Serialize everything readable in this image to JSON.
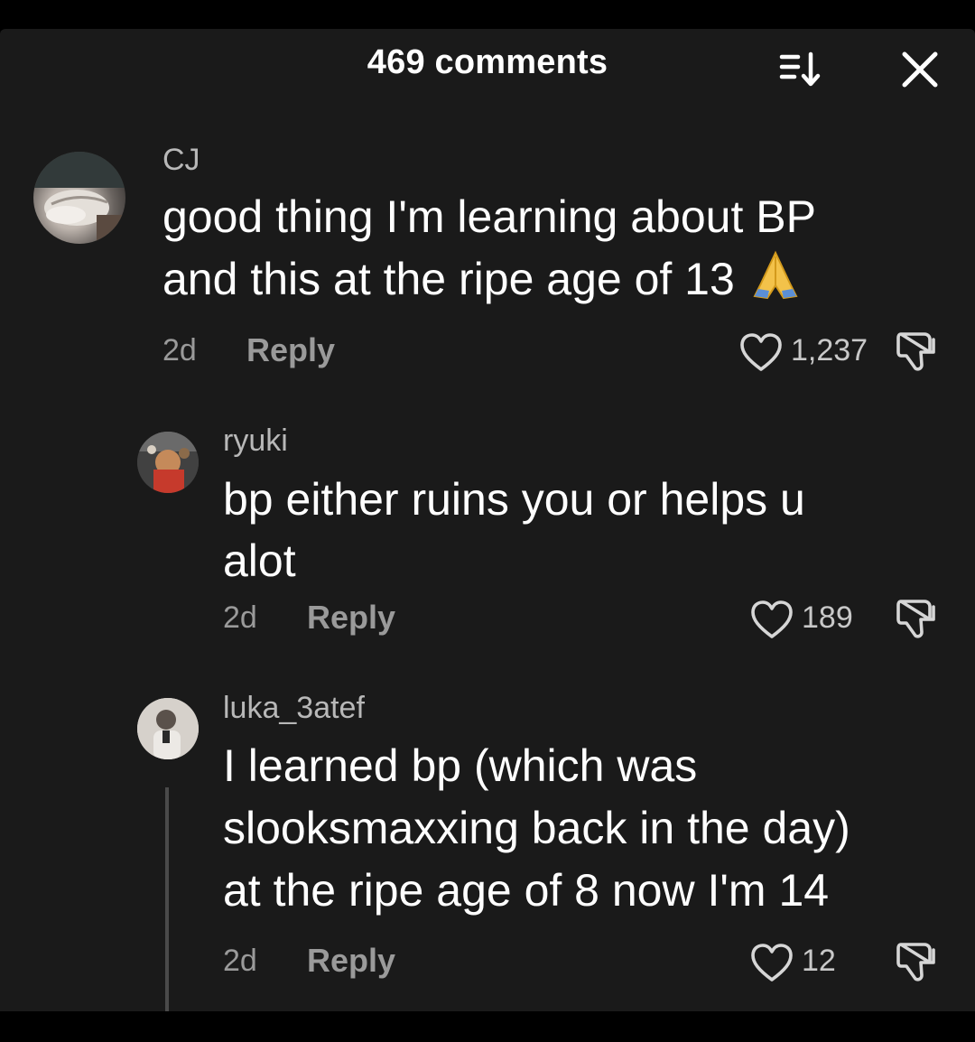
{
  "header": {
    "title": "469 comments"
  },
  "icons": {
    "sort": "sort-descending-icon",
    "close": "close-icon",
    "like": "heart-outline-icon",
    "dislike": "thumbs-down-icon",
    "pray": "folded-hands-emoji"
  },
  "comments": [
    {
      "username": "CJ",
      "text_line1": "good thing I'm learning about BP",
      "text_line2": "and this at the ripe age of 13",
      "time": "2d",
      "reply_label": "Reply",
      "likes": "1,237"
    },
    {
      "username": "ryuki",
      "text_line1": "bp either ruins you or helps u",
      "text_line2": "alot",
      "time": "2d",
      "reply_label": "Reply",
      "likes": "189"
    },
    {
      "username": "luka_3atef",
      "text_line1": "I learned bp (which was",
      "text_line2": "slooksmaxxing back in the day)",
      "text_line3": "at the ripe age of 8 now I'm 14",
      "time": "2d",
      "reply_label": "Reply",
      "likes": "12"
    }
  ]
}
